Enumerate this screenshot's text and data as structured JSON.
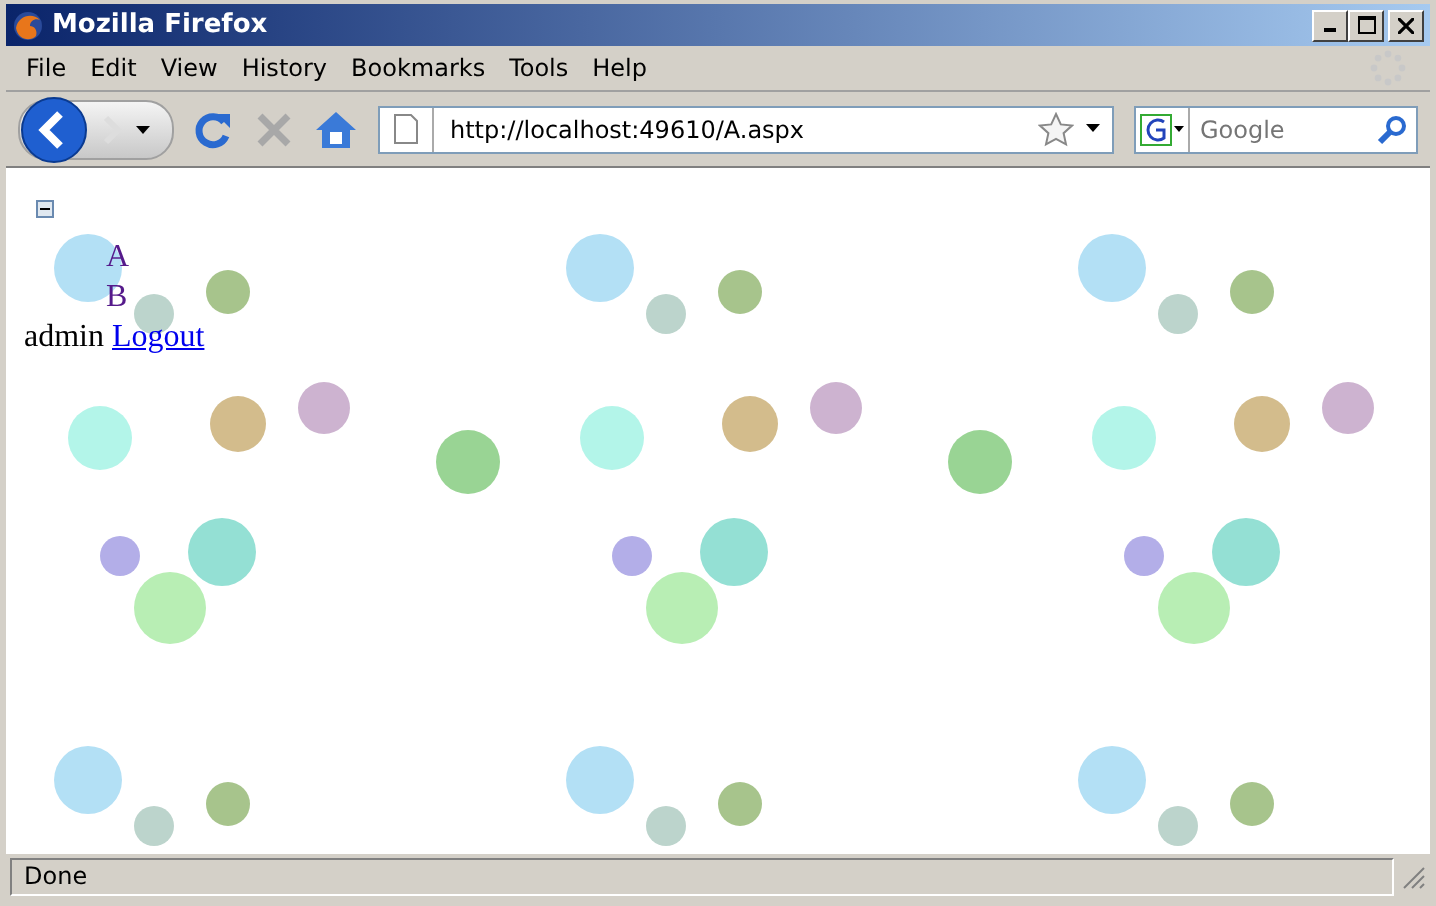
{
  "window": {
    "title": "Mozilla Firefox"
  },
  "menu": [
    "File",
    "Edit",
    "View",
    "History",
    "Bookmarks",
    "Tools",
    "Help"
  ],
  "address_bar": {
    "value": "http://localhost:49610/A.aspx"
  },
  "search": {
    "placeholder": "Google"
  },
  "tree": {
    "expanded": true,
    "nodes": [
      "A",
      "B"
    ]
  },
  "user": {
    "name": "admin",
    "logout": "Logout"
  },
  "status_bar": "Done"
}
